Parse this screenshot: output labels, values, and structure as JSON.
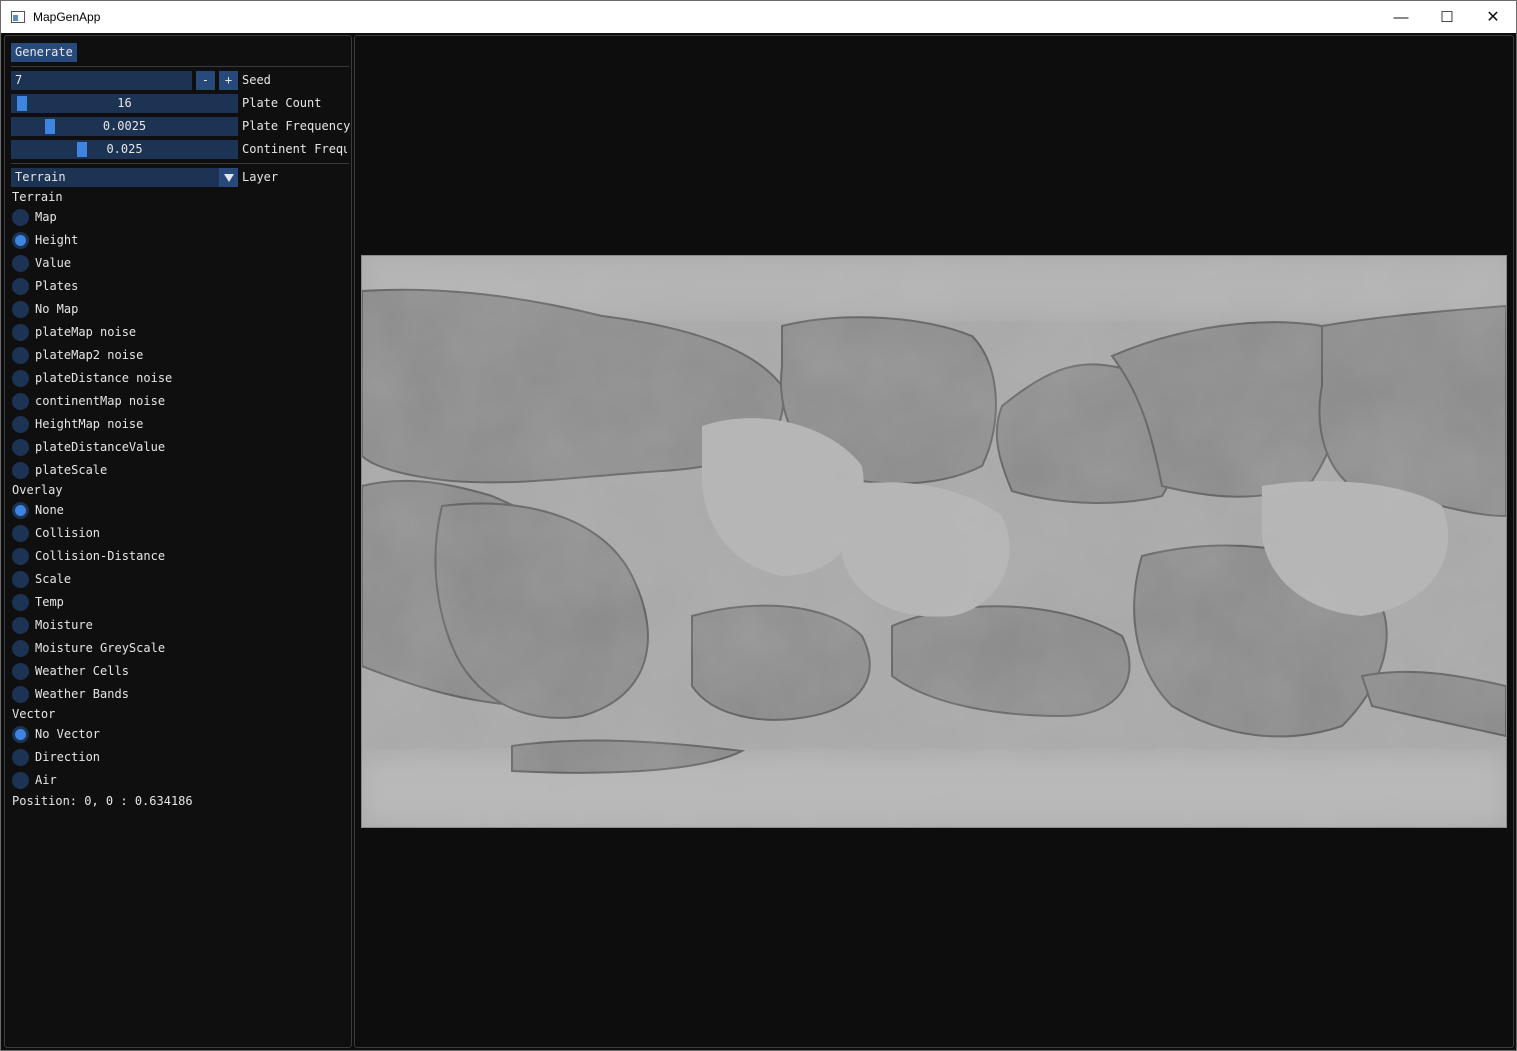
{
  "window": {
    "title": "MapGenApp",
    "minimize": "—",
    "maximize": "☐",
    "close": "✕"
  },
  "controls": {
    "generate_label": "Generate",
    "seed": {
      "value": "7",
      "minus": "-",
      "plus": "+",
      "label": "Seed"
    },
    "sliders": [
      {
        "label": "Plate Count",
        "value": "16",
        "fraction": 0.02
      },
      {
        "label": "Plate Frequency",
        "value": "0.0025",
        "fraction": 0.15
      },
      {
        "label": "Continent Frequ",
        "value": "0.025",
        "fraction": 0.3
      }
    ],
    "layer": {
      "selected": "Terrain",
      "label": "Layer"
    }
  },
  "terrain": {
    "header": "Terrain",
    "options": [
      "Map",
      "Height",
      "Value",
      "Plates",
      "No Map",
      "plateMap noise",
      "plateMap2 noise",
      "plateDistance noise",
      "continentMap noise",
      "HeightMap noise",
      "plateDistanceValue",
      "plateScale"
    ],
    "selected": "Height"
  },
  "overlay": {
    "header": "Overlay",
    "options": [
      "None",
      "Collision",
      "Collision-Distance",
      "Scale",
      "Temp",
      "Moisture",
      "Moisture GreyScale",
      "Weather Cells",
      "Weather Bands"
    ],
    "selected": "None"
  },
  "vector": {
    "header": "Vector",
    "options": [
      "No Vector",
      "Direction",
      "Air"
    ],
    "selected": "No Vector"
  },
  "status": {
    "text": "Position: 0, 0 : 0.634186"
  }
}
